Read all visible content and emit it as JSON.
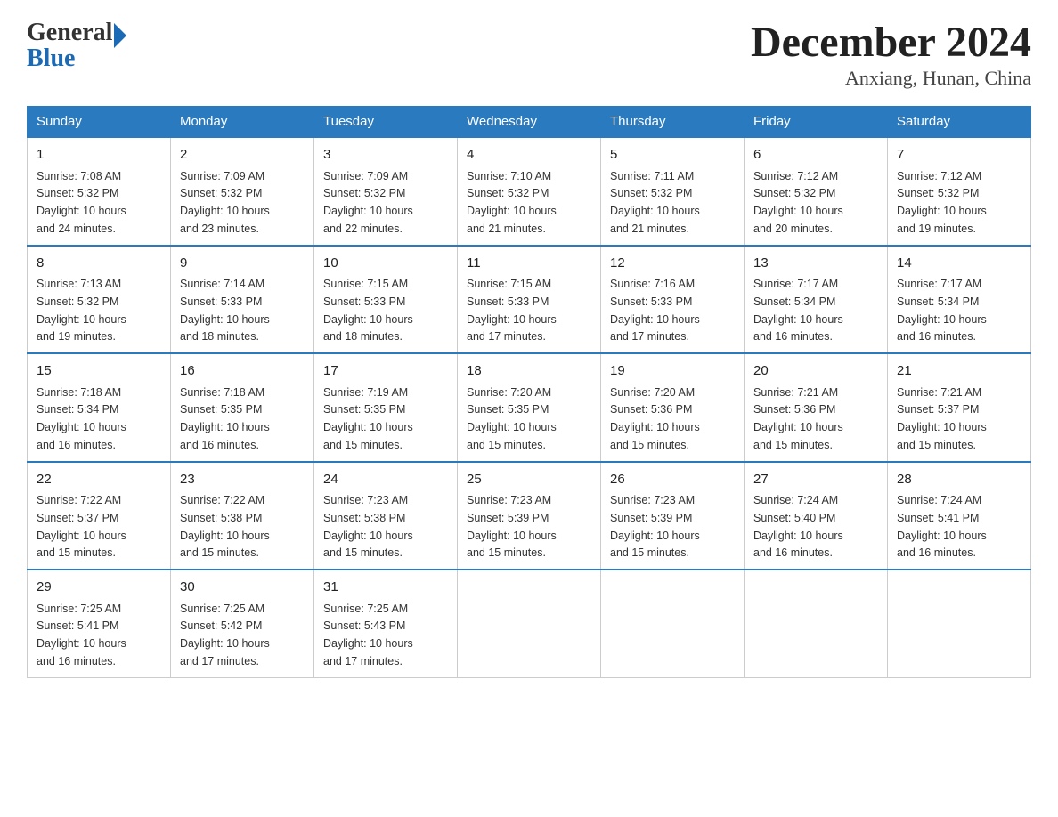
{
  "logo": {
    "text_general": "General",
    "text_blue": "Blue",
    "arrow": "▶"
  },
  "title": {
    "month": "December 2024",
    "location": "Anxiang, Hunan, China"
  },
  "weekdays": [
    "Sunday",
    "Monday",
    "Tuesday",
    "Wednesday",
    "Thursday",
    "Friday",
    "Saturday"
  ],
  "weeks": [
    [
      {
        "day": "1",
        "sunrise": "7:08 AM",
        "sunset": "5:32 PM",
        "daylight": "10 hours and 24 minutes."
      },
      {
        "day": "2",
        "sunrise": "7:09 AM",
        "sunset": "5:32 PM",
        "daylight": "10 hours and 23 minutes."
      },
      {
        "day": "3",
        "sunrise": "7:09 AM",
        "sunset": "5:32 PM",
        "daylight": "10 hours and 22 minutes."
      },
      {
        "day": "4",
        "sunrise": "7:10 AM",
        "sunset": "5:32 PM",
        "daylight": "10 hours and 21 minutes."
      },
      {
        "day": "5",
        "sunrise": "7:11 AM",
        "sunset": "5:32 PM",
        "daylight": "10 hours and 21 minutes."
      },
      {
        "day": "6",
        "sunrise": "7:12 AM",
        "sunset": "5:32 PM",
        "daylight": "10 hours and 20 minutes."
      },
      {
        "day": "7",
        "sunrise": "7:12 AM",
        "sunset": "5:32 PM",
        "daylight": "10 hours and 19 minutes."
      }
    ],
    [
      {
        "day": "8",
        "sunrise": "7:13 AM",
        "sunset": "5:32 PM",
        "daylight": "10 hours and 19 minutes."
      },
      {
        "day": "9",
        "sunrise": "7:14 AM",
        "sunset": "5:33 PM",
        "daylight": "10 hours and 18 minutes."
      },
      {
        "day": "10",
        "sunrise": "7:15 AM",
        "sunset": "5:33 PM",
        "daylight": "10 hours and 18 minutes."
      },
      {
        "day": "11",
        "sunrise": "7:15 AM",
        "sunset": "5:33 PM",
        "daylight": "10 hours and 17 minutes."
      },
      {
        "day": "12",
        "sunrise": "7:16 AM",
        "sunset": "5:33 PM",
        "daylight": "10 hours and 17 minutes."
      },
      {
        "day": "13",
        "sunrise": "7:17 AM",
        "sunset": "5:34 PM",
        "daylight": "10 hours and 16 minutes."
      },
      {
        "day": "14",
        "sunrise": "7:17 AM",
        "sunset": "5:34 PM",
        "daylight": "10 hours and 16 minutes."
      }
    ],
    [
      {
        "day": "15",
        "sunrise": "7:18 AM",
        "sunset": "5:34 PM",
        "daylight": "10 hours and 16 minutes."
      },
      {
        "day": "16",
        "sunrise": "7:18 AM",
        "sunset": "5:35 PM",
        "daylight": "10 hours and 16 minutes."
      },
      {
        "day": "17",
        "sunrise": "7:19 AM",
        "sunset": "5:35 PM",
        "daylight": "10 hours and 15 minutes."
      },
      {
        "day": "18",
        "sunrise": "7:20 AM",
        "sunset": "5:35 PM",
        "daylight": "10 hours and 15 minutes."
      },
      {
        "day": "19",
        "sunrise": "7:20 AM",
        "sunset": "5:36 PM",
        "daylight": "10 hours and 15 minutes."
      },
      {
        "day": "20",
        "sunrise": "7:21 AM",
        "sunset": "5:36 PM",
        "daylight": "10 hours and 15 minutes."
      },
      {
        "day": "21",
        "sunrise": "7:21 AM",
        "sunset": "5:37 PM",
        "daylight": "10 hours and 15 minutes."
      }
    ],
    [
      {
        "day": "22",
        "sunrise": "7:22 AM",
        "sunset": "5:37 PM",
        "daylight": "10 hours and 15 minutes."
      },
      {
        "day": "23",
        "sunrise": "7:22 AM",
        "sunset": "5:38 PM",
        "daylight": "10 hours and 15 minutes."
      },
      {
        "day": "24",
        "sunrise": "7:23 AM",
        "sunset": "5:38 PM",
        "daylight": "10 hours and 15 minutes."
      },
      {
        "day": "25",
        "sunrise": "7:23 AM",
        "sunset": "5:39 PM",
        "daylight": "10 hours and 15 minutes."
      },
      {
        "day": "26",
        "sunrise": "7:23 AM",
        "sunset": "5:39 PM",
        "daylight": "10 hours and 15 minutes."
      },
      {
        "day": "27",
        "sunrise": "7:24 AM",
        "sunset": "5:40 PM",
        "daylight": "10 hours and 16 minutes."
      },
      {
        "day": "28",
        "sunrise": "7:24 AM",
        "sunset": "5:41 PM",
        "daylight": "10 hours and 16 minutes."
      }
    ],
    [
      {
        "day": "29",
        "sunrise": "7:25 AM",
        "sunset": "5:41 PM",
        "daylight": "10 hours and 16 minutes."
      },
      {
        "day": "30",
        "sunrise": "7:25 AM",
        "sunset": "5:42 PM",
        "daylight": "10 hours and 17 minutes."
      },
      {
        "day": "31",
        "sunrise": "7:25 AM",
        "sunset": "5:43 PM",
        "daylight": "10 hours and 17 minutes."
      },
      null,
      null,
      null,
      null
    ]
  ],
  "labels": {
    "sunrise": "Sunrise:",
    "sunset": "Sunset:",
    "daylight": "Daylight:"
  }
}
